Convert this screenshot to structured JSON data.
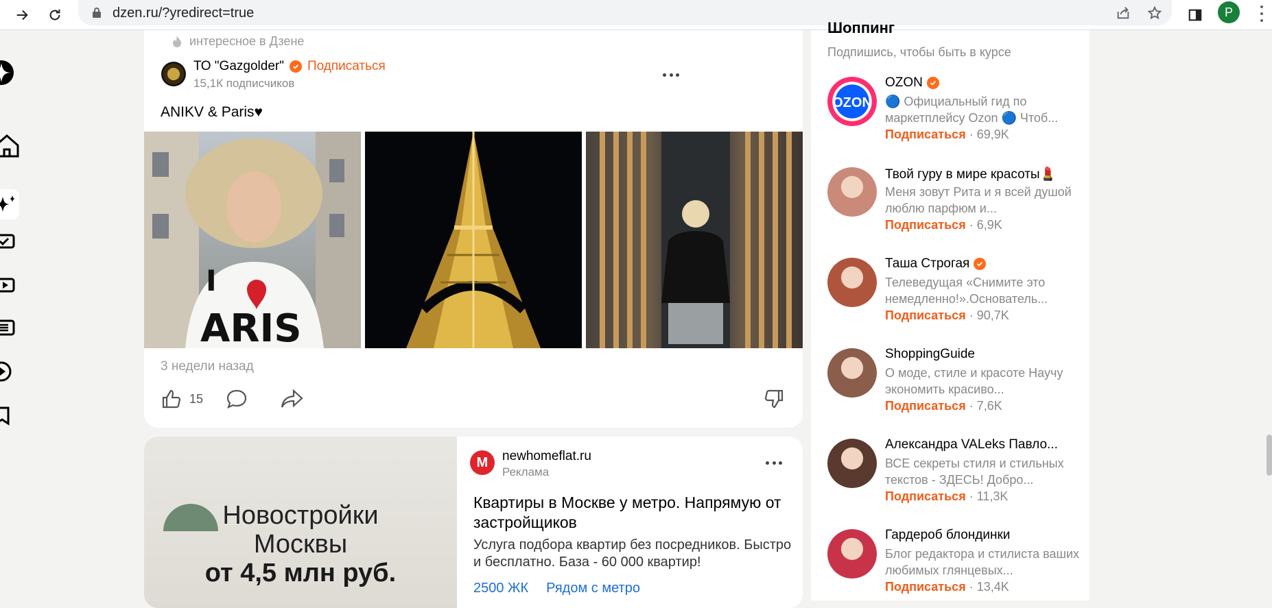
{
  "browser": {
    "url": "dzen.ru/?yredirect=true",
    "avatar_letter": "P"
  },
  "post": {
    "source_label": "интересное в Дзене",
    "channel": "ТО \"Gazgolder\"",
    "subscribe": "Подписаться",
    "subscribers": "15,1К подписчиков",
    "text": "ANIKV & Paris♥",
    "date": "3 недели назад",
    "likes": "15"
  },
  "ad": {
    "image_line1": "Новостройки",
    "image_line2": "Москвы",
    "image_line3": "от 4,5 млн руб.",
    "logo": "M",
    "source": "newhomeflat.ru",
    "label": "Реклама",
    "title": "Квартиры в Москве у метро. Напрямую от застройщиков",
    "description": "Услуга подбора квартир без посредников. Быстро и бесплатно. База - 60 000 квартир!",
    "links": [
      "2500 ЖК",
      "Рядом с метро"
    ]
  },
  "right_panel": {
    "title": "Шоппинг",
    "subtitle": "Подпишись, чтобы быть в курсе",
    "subscribe_label": "Подписаться",
    "channels": [
      {
        "name": "OZON",
        "verified": true,
        "desc": "🔵 Официальный гид по маркетплейсу Ozon 🔵 Чтоб...",
        "count": "69,9K",
        "color": "#0a5cff"
      },
      {
        "name": "Твой гуру в мире красоты💄",
        "verified": false,
        "desc": "Меня зовут Рита и я всей душой люблю парфюм и...",
        "count": "6,9K",
        "color": "#c98a7a"
      },
      {
        "name": "Таша Строгая",
        "verified": true,
        "desc": "Телеведущая «Снимите это немедленно!».Основатель...",
        "count": "90,7K",
        "color": "#b0553d"
      },
      {
        "name": "ShoppingGuide",
        "verified": false,
        "desc": "О моде, стиле и красоте Научу экономить красиво...",
        "count": "7,6K",
        "color": "#8b5e4b"
      },
      {
        "name": "Александра VALeks Павло...",
        "verified": false,
        "desc": "ВСЕ секреты стиля и стильных текстов - ЗДЕСЬ! Добро...",
        "count": "11,3K",
        "color": "#5a3a2e"
      },
      {
        "name": "Гардероб блондинки",
        "verified": false,
        "desc": "Блог редактора и стилиста ваших любимых глянцевых...",
        "count": "13,4K",
        "color": "#c8334a"
      }
    ]
  }
}
